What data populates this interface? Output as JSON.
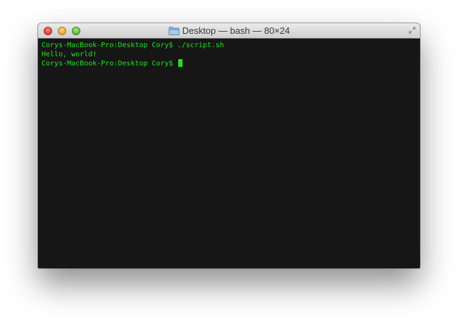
{
  "window": {
    "title": "Desktop — bash — 80×24"
  },
  "terminal": {
    "lines": [
      {
        "prompt": "Corys-MacBook-Pro:Desktop Cory$",
        "command": "./script.sh"
      },
      {
        "output": "Hello, world!"
      },
      {
        "prompt": "Corys-MacBook-Pro:Desktop Cory$",
        "command": ""
      }
    ]
  },
  "icons": {
    "close": "close-button",
    "minimize": "minimize-button",
    "zoom": "zoom-button",
    "title": "folder-icon",
    "fullscreen": "fullscreen-icon"
  },
  "colors": {
    "terminal_background": "#161616",
    "terminal_text": "#21e221",
    "cursor": "#21e221"
  }
}
